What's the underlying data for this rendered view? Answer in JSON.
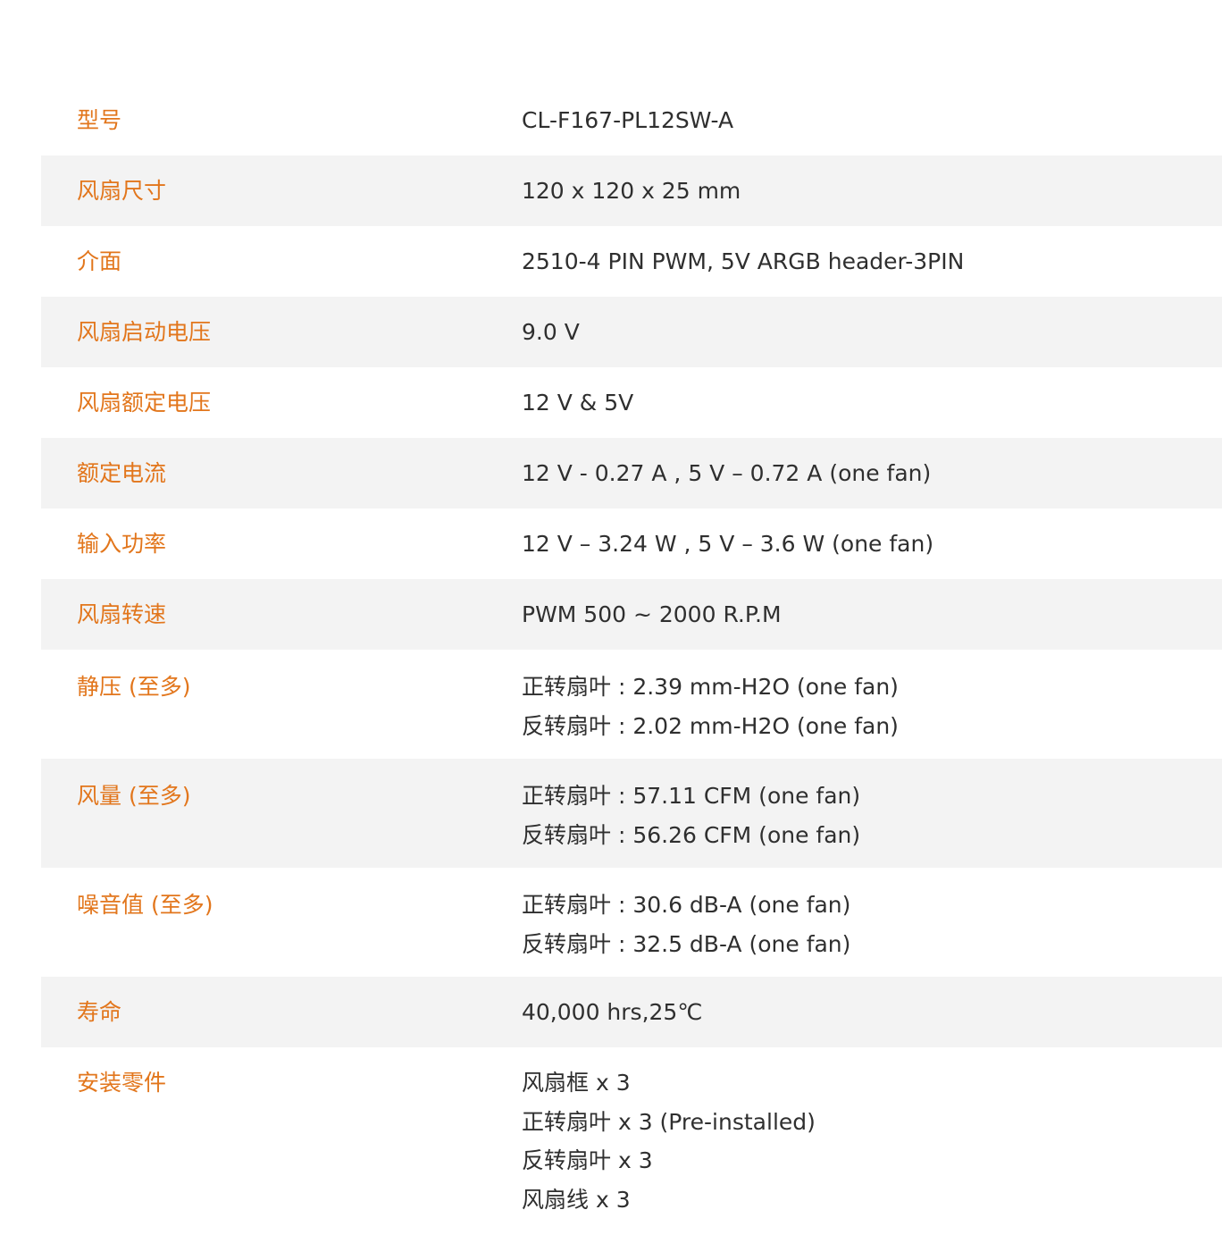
{
  "specs": [
    {
      "label": "型号",
      "values": [
        "CL-F167-PL12SW-A"
      ]
    },
    {
      "label": "风扇尺寸",
      "values": [
        "120 x 120 x 25 mm"
      ]
    },
    {
      "label": "介面",
      "values": [
        "2510-4 PIN PWM, 5V ARGB header-3PIN"
      ]
    },
    {
      "label": "风扇启动电压",
      "values": [
        "9.0 V"
      ]
    },
    {
      "label": "风扇额定电压",
      "values": [
        "12 V & 5V"
      ]
    },
    {
      "label": "额定电流",
      "values": [
        "12 V - 0.27 A , 5 V – 0.72 A (one fan)"
      ]
    },
    {
      "label": "输入功率",
      "values": [
        "12 V – 3.24 W , 5 V – 3.6 W (one fan)"
      ]
    },
    {
      "label": "风扇转速",
      "values": [
        "PWM 500 ~ 2000 R.P.M"
      ]
    },
    {
      "label": "静压 (至多)",
      "values": [
        "正转扇叶 : 2.39 mm-H2O (one fan)",
        "反转扇叶 : 2.02 mm-H2O (one fan)"
      ]
    },
    {
      "label": "风量 (至多)",
      "values": [
        "正转扇叶 : 57.11 CFM (one fan)",
        "反转扇叶 : 56.26 CFM (one fan)"
      ]
    },
    {
      "label": "噪音值 (至多)",
      "values": [
        "正转扇叶 : 30.6 dB-A (one fan)",
        "反转扇叶 : 32.5 dB-A (one fan)"
      ]
    },
    {
      "label": "寿命",
      "values": [
        "40,000 hrs,25℃"
      ]
    },
    {
      "label": "安装零件",
      "values": [
        "风扇框 x 3",
        "正转扇叶 x 3 (Pre-installed)",
        "反转扇叶 x 3",
        "风扇线 x 3"
      ]
    }
  ],
  "colors": {
    "label": "#e2761c",
    "value": "#2f2f2f",
    "row_shade": "#f3f3f3"
  }
}
